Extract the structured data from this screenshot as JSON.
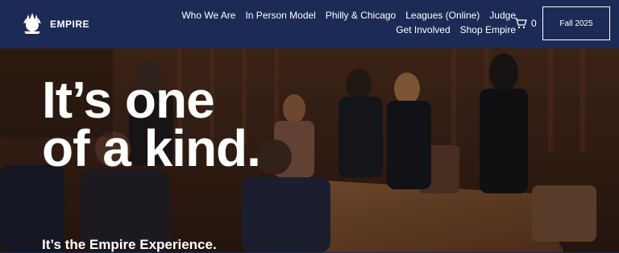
{
  "brand": {
    "name": "EMPIRE",
    "logo_icon": "statue-of-liberty-logo-icon"
  },
  "nav": {
    "items": [
      "Who We Are",
      "In Person Model",
      "Philly & Chicago",
      "Leagues (Online)",
      "Judge",
      "Get Involved",
      "Shop Empire"
    ]
  },
  "cart": {
    "icon": "cart-icon",
    "count": "0"
  },
  "season_button": "Fall 2025",
  "hero": {
    "headline_line1": "It’s one",
    "headline_line2": "of a kind.",
    "subline": "It’s the Empire Experience."
  },
  "colors": {
    "header_bg": "#1c2b56",
    "text": "#ffffff"
  }
}
